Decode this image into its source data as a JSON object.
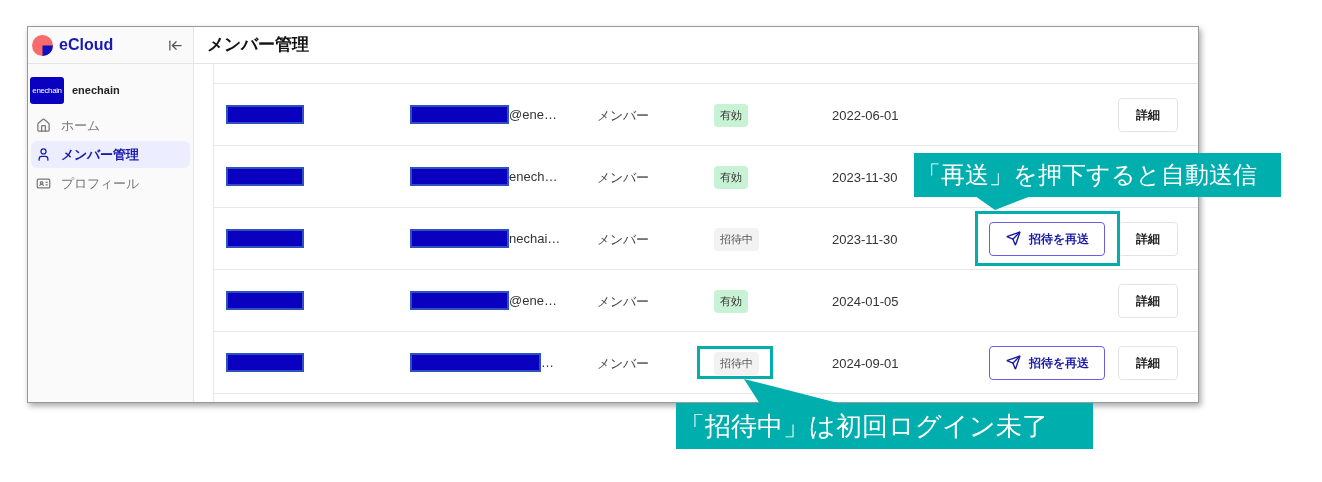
{
  "app": {
    "name": "eCloud"
  },
  "page_title": "メンバー管理",
  "org": {
    "avatar_text": "enechain",
    "name": "enechain"
  },
  "nav": [
    {
      "label": "ホーム",
      "kind": "home",
      "selected": false
    },
    {
      "label": "メンバー管理",
      "kind": "user",
      "selected": true
    },
    {
      "label": "プロフィール",
      "kind": "card",
      "selected": false
    }
  ],
  "members": [
    {
      "email_suffix": "@ene…",
      "role": "メンバー",
      "status": {
        "label": "有効",
        "kind": "active"
      },
      "date": "2022-06-01",
      "detail_button": "詳細"
    },
    {
      "email_suffix": "enech…",
      "role": "メンバー",
      "status": {
        "label": "有効",
        "kind": "active"
      },
      "date": "2023-11-30"
    },
    {
      "email_suffix": "nechai…",
      "role": "メンバー",
      "status": {
        "label": "招待中",
        "kind": "invited"
      },
      "date": "2023-11-30",
      "resend_button": "招待を再送",
      "detail_button": "詳細"
    },
    {
      "email_suffix": "@ene…",
      "role": "メンバー",
      "status": {
        "label": "有効",
        "kind": "active"
      },
      "date": "2024-01-05",
      "detail_button": "詳細"
    },
    {
      "email_suffix": "…",
      "role": "メンバー",
      "status": {
        "label": "招待中",
        "kind": "invited"
      },
      "date": "2024-09-01",
      "resend_button": "招待を再送",
      "detail_button": "詳細"
    }
  ],
  "annotations": [
    {
      "text": "「再送」を押下すると自動送信",
      "kind": "resend"
    },
    {
      "text": "「招待中」は初回ログイン未了",
      "kind": "status"
    }
  ]
}
